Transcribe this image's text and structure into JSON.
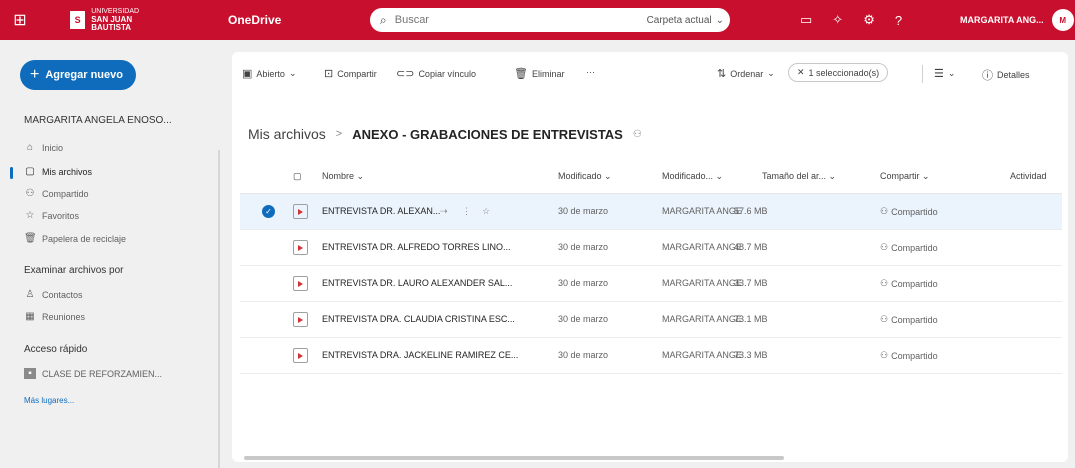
{
  "header": {
    "waffle_icon": "waffle-icon",
    "logo_small": "UNIVERSIDAD",
    "logo_big": "SAN JUAN BAUTISTA",
    "app_name": "OneDrive",
    "search_placeholder": "Buscar",
    "search_scope": "Carpeta actual",
    "user_name": "MARGARITA ANG...",
    "avatar_initials": "M",
    "brand_color": "#c8102e"
  },
  "nav": {
    "new_button": "Agregar nuevo",
    "account": "MARGARITA ANGELA ENOSO...",
    "items": [
      {
        "label": "Inicio",
        "icon": "home-icon"
      },
      {
        "label": "Mis archivos",
        "icon": "folder-icon"
      },
      {
        "label": "Compartido",
        "icon": "people-icon"
      },
      {
        "label": "Favoritos",
        "icon": "star-icon"
      },
      {
        "label": "Papelera de reciclaje",
        "icon": "trash-icon"
      }
    ],
    "browse_title": "Examinar archivos por",
    "browse_items": [
      {
        "label": "Contactos",
        "icon": "contact-icon"
      },
      {
        "label": "Reuniones",
        "icon": "calendar-icon"
      }
    ],
    "quick_title": "Acceso rápido",
    "quick_items": [
      {
        "label": "CLASE DE REFORZAMIEN...",
        "icon": "group-icon"
      }
    ],
    "more_places": "Más lugares..."
  },
  "toolbar": {
    "open": "Abierto",
    "share": "Compartir",
    "copy_link": "Copiar vínculo",
    "delete": "Eliminar",
    "more": "···",
    "sort": "Ordenar",
    "selected": "1 seleccionado(s)",
    "details": "Detalles"
  },
  "breadcrumb": {
    "root": "Mis archivos",
    "separator": ">",
    "current": "ANEXO - GRABACIONES DE ENTREVISTAS"
  },
  "table": {
    "headers": {
      "name": "Nombre",
      "modified": "Modificado",
      "modified_by": "Modificado...",
      "size": "Tamaño del ar...",
      "sharing": "Compartir",
      "activity": "Actividad"
    },
    "rows": [
      {
        "name": "ENTREVISTA DR. ALEXAN...",
        "modified": "30 de marzo",
        "by": "MARGARITA ANGE",
        "size": "57.6 MB",
        "sharing": "Compartido"
      },
      {
        "name": "ENTREVISTA DR. ALFREDO TORRES LINO...",
        "modified": "30 de marzo",
        "by": "MARGARITA ANGE",
        "size": "48.7 MB",
        "sharing": "Compartido"
      },
      {
        "name": "ENTREVISTA DR. LAURO ALEXANDER SAL...",
        "modified": "30 de marzo",
        "by": "MARGARITA ANGE",
        "size": "33.7 MB",
        "sharing": "Compartido"
      },
      {
        "name": "ENTREVISTA DRA. CLAUDIA CRISTINA ESC...",
        "modified": "30 de marzo",
        "by": "MARGARITA ANGE",
        "size": "73.1 MB",
        "sharing": "Compartido"
      },
      {
        "name": "ENTREVISTA DRA. JACKELINE RAMIREZ CE...",
        "modified": "30 de marzo",
        "by": "MARGARITA ANGE",
        "size": "73.3 MB",
        "sharing": "Compartido"
      }
    ]
  }
}
